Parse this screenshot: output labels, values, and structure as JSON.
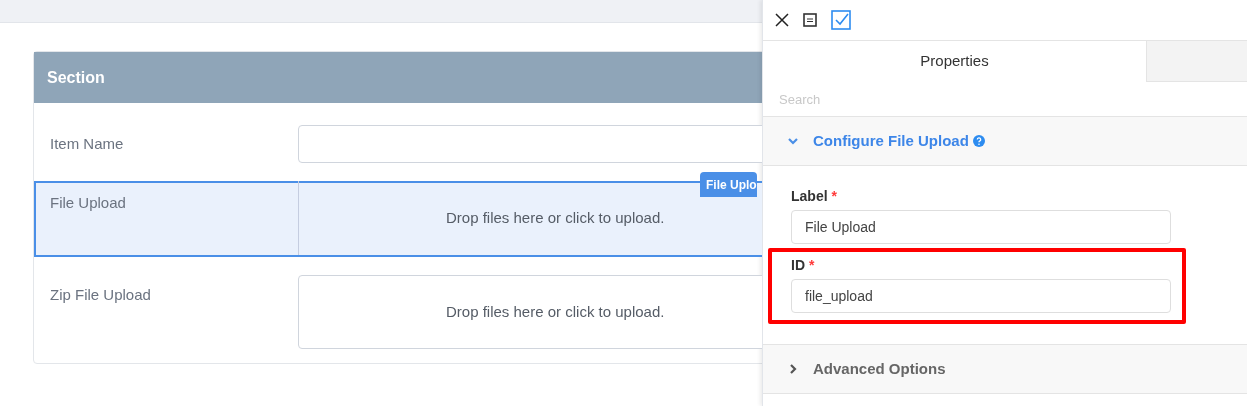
{
  "form": {
    "section_title": "Section",
    "rows": [
      {
        "kind": "text",
        "label": "Item Name",
        "selected": false
      },
      {
        "kind": "upload",
        "label": "File Upload",
        "dropzone": "Drop files here or click to upload.",
        "selected": true,
        "tag": "File Uplo"
      },
      {
        "kind": "upload",
        "label": "Zip File Upload",
        "dropzone": "Drop files here or click to upload.",
        "selected": false
      }
    ]
  },
  "panel": {
    "tabs": [
      {
        "label": "Properties",
        "selected": true
      },
      {
        "selected": false
      }
    ],
    "search": {
      "placeholder": "Search"
    },
    "sections": [
      {
        "title": "Configure File Upload",
        "expanded": true,
        "help": true,
        "fields": [
          {
            "label": "Label",
            "required_mark": "*",
            "value": "File Upload",
            "highlighted": false
          },
          {
            "label": "ID",
            "required_mark": "*",
            "value": "file_upload",
            "highlighted": true
          }
        ]
      },
      {
        "title": "Advanced Options",
        "expanded": false,
        "help": false
      }
    ]
  }
}
